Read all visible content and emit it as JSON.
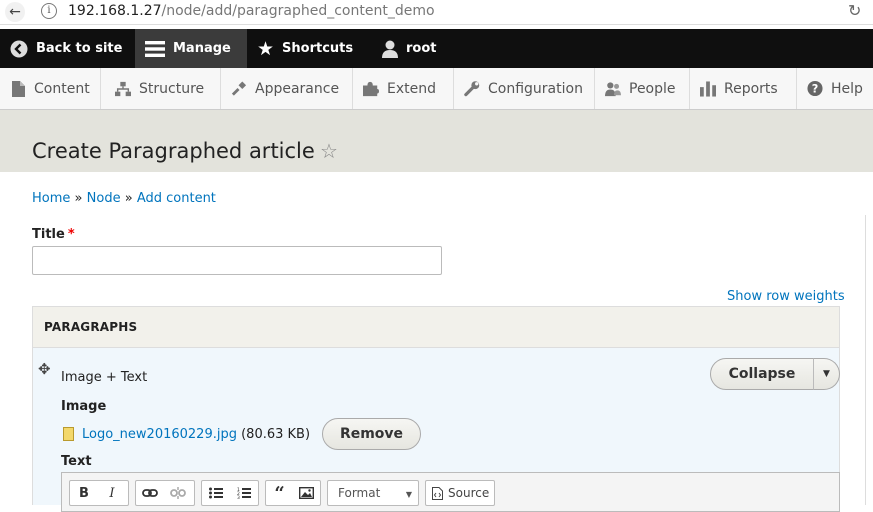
{
  "browser": {
    "url_host": "192.168.1.27",
    "url_path": "/node/add/paragraphed_content_demo"
  },
  "toolbar": {
    "back_to_site": "Back to site",
    "manage": "Manage",
    "shortcuts": "Shortcuts",
    "user": "root"
  },
  "tray": {
    "items": [
      {
        "label": "Content",
        "icon": "file-icon"
      },
      {
        "label": "Structure",
        "icon": "sitemap-icon"
      },
      {
        "label": "Appearance",
        "icon": "paint-icon"
      },
      {
        "label": "Extend",
        "icon": "puzzle-icon"
      },
      {
        "label": "Configuration",
        "icon": "wrench-icon"
      },
      {
        "label": "People",
        "icon": "people-icon"
      },
      {
        "label": "Reports",
        "icon": "bar-chart-icon"
      },
      {
        "label": "Help",
        "icon": "question-icon"
      }
    ]
  },
  "page": {
    "title": "Create Paragraphed article",
    "breadcrumb": [
      "Home",
      "Node",
      "Add content"
    ],
    "breadcrumb_sep": "»"
  },
  "form": {
    "title_label": "Title",
    "required_mark": "*",
    "title_value": "",
    "show_row_weights": "Show row weights",
    "paragraphs_label": "PARAGRAPHS",
    "paragraph": {
      "type": "Image + Text",
      "collapse": "Collapse",
      "image_label": "Image",
      "file_name": "Logo_new20160229.jpg",
      "file_size": "(80.63 KB)",
      "remove": "Remove",
      "text_label": "Text"
    },
    "editor": {
      "format": "Format",
      "source": "Source"
    }
  }
}
